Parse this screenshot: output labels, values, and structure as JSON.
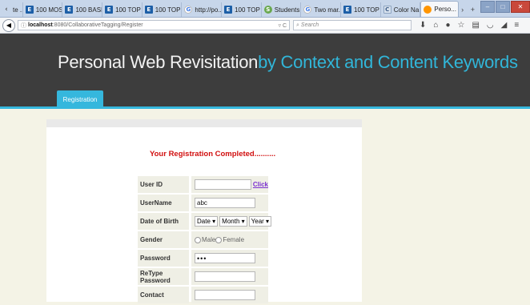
{
  "browser": {
    "tabs": [
      {
        "label": "te ...",
        "icon": "generic"
      },
      {
        "label": "100 MOS...",
        "icon": "e"
      },
      {
        "label": "100 BASI...",
        "icon": "e"
      },
      {
        "label": "100 TOP ...",
        "icon": "e"
      },
      {
        "label": "100 TOP ...",
        "icon": "e"
      },
      {
        "label": "http://po...",
        "icon": "g"
      },
      {
        "label": "100 TOP ...",
        "icon": "e"
      },
      {
        "label": "Students ...",
        "icon": "s"
      },
      {
        "label": "Two mar...",
        "icon": "g"
      },
      {
        "label": "100 TOP ...",
        "icon": "e"
      },
      {
        "label": "Color Na...",
        "icon": "c"
      },
      {
        "label": "Perso...",
        "icon": "f",
        "active": true
      }
    ],
    "url_host": "localhost",
    "url_path": ":8080/CollaborativeTagging/Register",
    "search_placeholder": "Search"
  },
  "header": {
    "title_white": "Personal Web Revisitation",
    "title_blue": "by Context and Content Keywords",
    "nav_tab": "Registration",
    "colors": {
      "dark": "#3d3d3d",
      "accent": "#35b7dd"
    }
  },
  "form": {
    "message": "Your Registration Completed..........",
    "user_id_label": "User ID",
    "user_id_value": "",
    "click_label": "Click",
    "username_label": "UserName",
    "username_value": "abc",
    "dob_label": "Date of Birth",
    "dob_date": "Date",
    "dob_month": "Month",
    "dob_year": "Year",
    "gender_label": "Gender",
    "gender_male": "Male",
    "gender_female": "Female",
    "password_label": "Password",
    "password_value": "•••",
    "retype_label": "ReType Password",
    "retype_value": "",
    "contact_label": "Contact",
    "contact_value": ""
  }
}
